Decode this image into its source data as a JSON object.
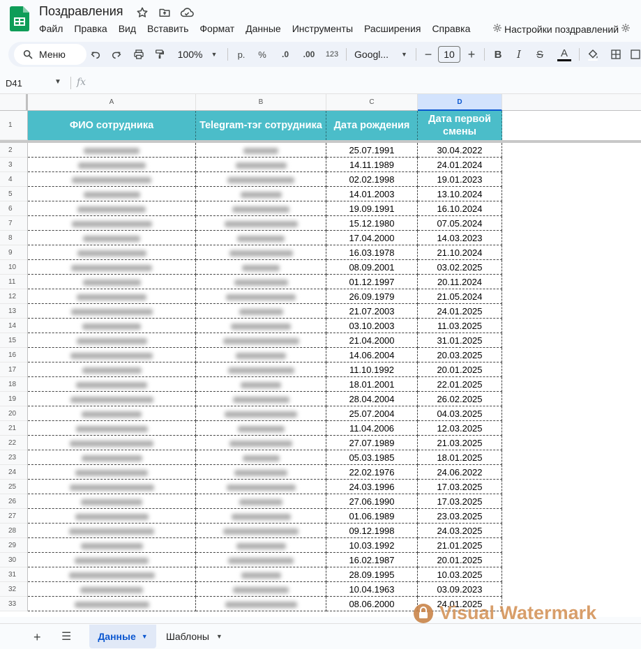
{
  "app": {
    "title": "Поздравления",
    "menu": [
      "Файл",
      "Правка",
      "Вид",
      "Вставить",
      "Формат",
      "Данные",
      "Инструменты",
      "Расширения",
      "Справка"
    ],
    "extension_menu": "Настройки поздравлений"
  },
  "toolbar": {
    "search_label": "Меню",
    "zoom": "100%",
    "currency": "р.",
    "percent": "%",
    "dec_decrease": ".0",
    "dec_increase": ".00",
    "number_format": "123",
    "font": "Googl...",
    "font_size": "10",
    "bold": "B",
    "italic": "I",
    "strike": "S",
    "text_color": "A"
  },
  "formula_bar": {
    "cell_ref": "D41",
    "fx": "fx"
  },
  "grid": {
    "columns": [
      "A",
      "B",
      "C",
      "D"
    ],
    "selected_column": "D",
    "header_row_number": "1",
    "headers": [
      "ФИО сотрудника",
      "Telegram-тэг сотрудника",
      "Дата рождения",
      "Дата первой смены"
    ],
    "rows": [
      {
        "n": "2",
        "birth": "25.07.1991",
        "first": "30.04.2022"
      },
      {
        "n": "3",
        "birth": "14.11.1989",
        "first": "24.01.2024"
      },
      {
        "n": "4",
        "birth": "02.02.1998",
        "first": "19.01.2023"
      },
      {
        "n": "5",
        "birth": "14.01.2003",
        "first": "13.10.2024"
      },
      {
        "n": "6",
        "birth": "19.09.1991",
        "first": "16.10.2024"
      },
      {
        "n": "7",
        "birth": "15.12.1980",
        "first": "07.05.2024"
      },
      {
        "n": "8",
        "birth": "17.04.2000",
        "first": "14.03.2023"
      },
      {
        "n": "9",
        "birth": "16.03.1978",
        "first": "21.10.2024"
      },
      {
        "n": "10",
        "birth": "08.09.2001",
        "first": "03.02.2025"
      },
      {
        "n": "11",
        "birth": "01.12.1997",
        "first": "20.11.2024"
      },
      {
        "n": "12",
        "birth": "26.09.1979",
        "first": "21.05.2024"
      },
      {
        "n": "13",
        "birth": "21.07.2003",
        "first": "24.01.2025"
      },
      {
        "n": "14",
        "birth": "03.10.2003",
        "first": "11.03.2025"
      },
      {
        "n": "15",
        "birth": "21.04.2000",
        "first": "31.01.2025"
      },
      {
        "n": "16",
        "birth": "14.06.2004",
        "first": "20.03.2025"
      },
      {
        "n": "17",
        "birth": "11.10.1992",
        "first": "20.01.2025"
      },
      {
        "n": "18",
        "birth": "18.01.2001",
        "first": "22.01.2025"
      },
      {
        "n": "19",
        "birth": "28.04.2004",
        "first": "26.02.2025"
      },
      {
        "n": "20",
        "birth": "25.07.2004",
        "first": "04.03.2025"
      },
      {
        "n": "21",
        "birth": "11.04.2006",
        "first": "12.03.2025"
      },
      {
        "n": "22",
        "birth": "27.07.1989",
        "first": "21.03.2025"
      },
      {
        "n": "23",
        "birth": "05.03.1985",
        "first": "18.01.2025"
      },
      {
        "n": "24",
        "birth": "22.02.1976",
        "first": "24.06.2022"
      },
      {
        "n": "25",
        "birth": "24.03.1996",
        "first": "17.03.2025"
      },
      {
        "n": "26",
        "birth": "27.06.1990",
        "first": "17.03.2025"
      },
      {
        "n": "27",
        "birth": "01.06.1989",
        "first": "23.03.2025"
      },
      {
        "n": "28",
        "birth": "09.12.1998",
        "first": "24.03.2025"
      },
      {
        "n": "29",
        "birth": "10.03.1992",
        "first": "21.01.2025"
      },
      {
        "n": "30",
        "birth": "16.02.1987",
        "first": "20.01.2025"
      },
      {
        "n": "31",
        "birth": "28.09.1995",
        "first": "10.03.2025"
      },
      {
        "n": "32",
        "birth": "10.04.1963",
        "first": "03.09.2023"
      },
      {
        "n": "33",
        "birth": "08.06.2000",
        "first": "24.01.2025"
      }
    ]
  },
  "sheets": {
    "active": "Данные",
    "other": "Шаблоны"
  },
  "watermark": "Visual Watermark",
  "colors": {
    "header_fill": "#4bbdc9",
    "accent": "#0b57d0",
    "sheets_green": "#0f9d58"
  }
}
